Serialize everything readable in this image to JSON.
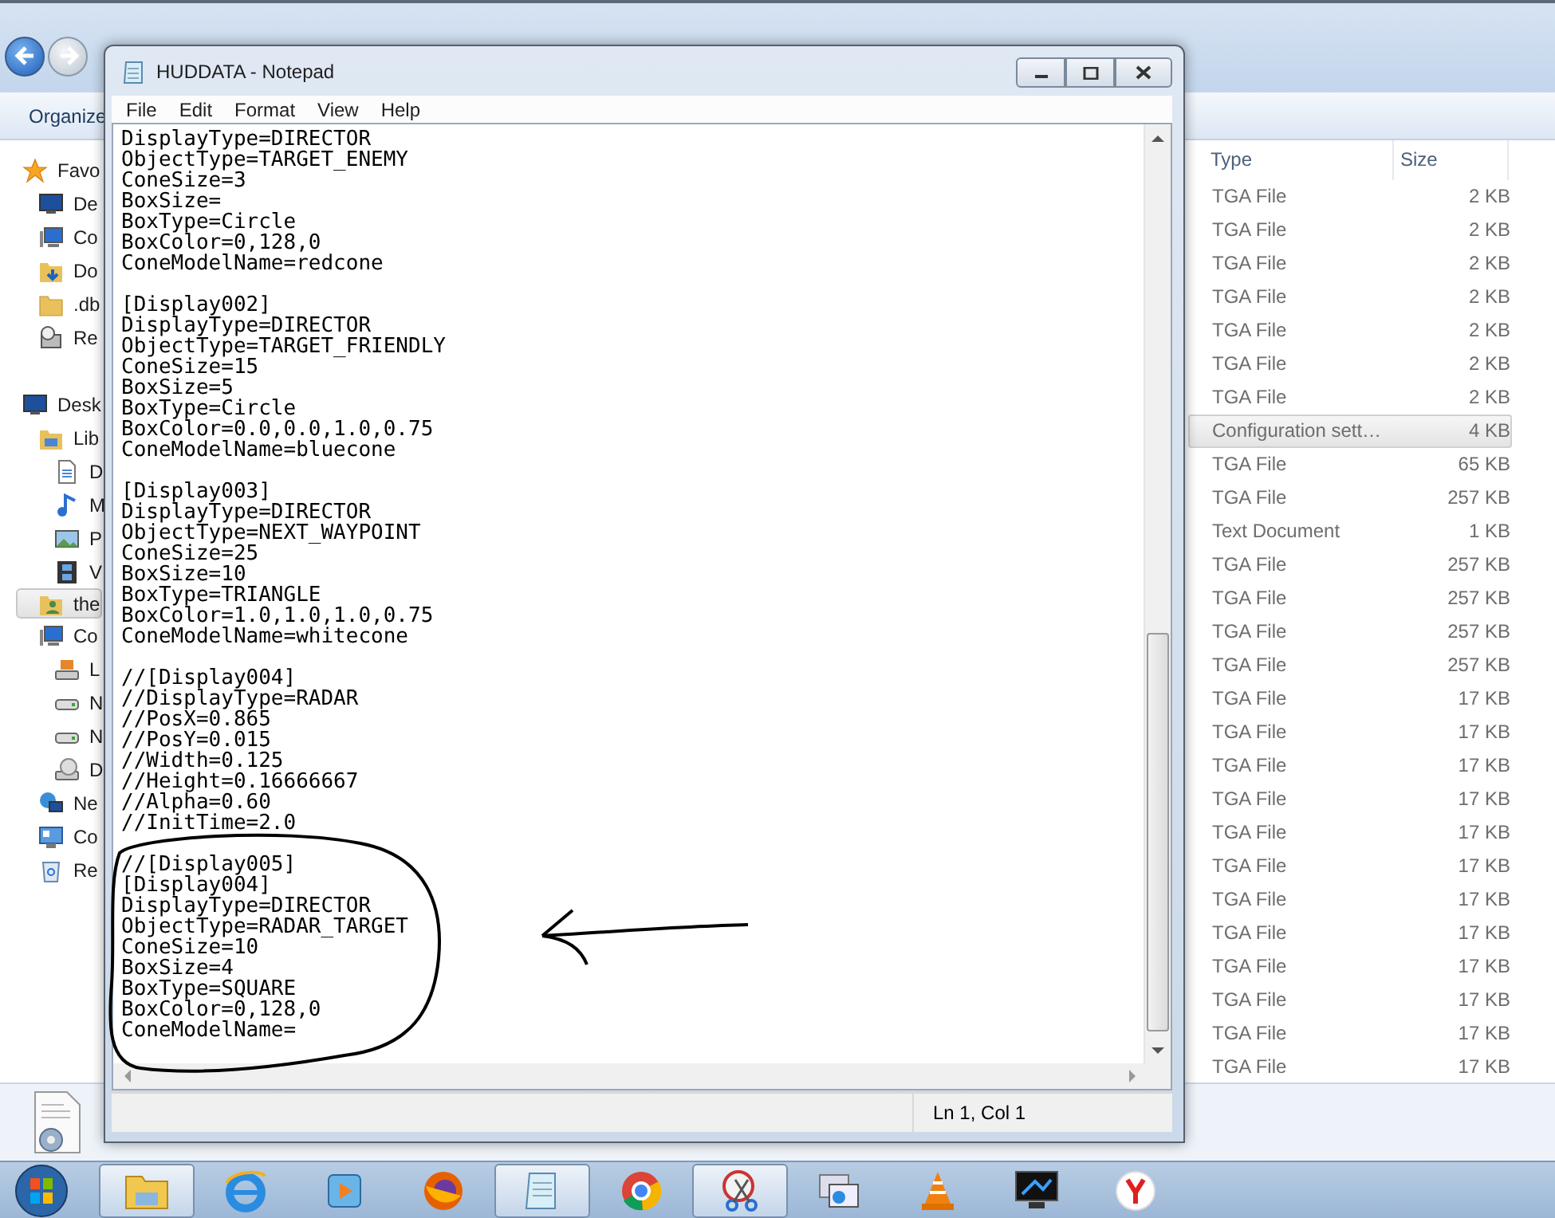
{
  "explorer": {
    "toolbar": {
      "organize": "Organize"
    },
    "nav": [
      {
        "label": "Favo",
        "kind": "star",
        "selected": false,
        "children": [
          {
            "label": "De",
            "kind": "desktop",
            "selected": false
          },
          {
            "label": "Co",
            "kind": "computer",
            "selected": false
          },
          {
            "label": "Do",
            "kind": "download",
            "selected": false
          },
          {
            "label": ".db",
            "kind": "folder",
            "selected": false
          },
          {
            "label": "Re",
            "kind": "recent",
            "selected": false
          }
        ]
      },
      {
        "label": "Desk",
        "kind": "desktop",
        "selected": false,
        "children": [
          {
            "label": "Lib",
            "kind": "library",
            "selected": false,
            "children": [
              {
                "label": "D",
                "kind": "document",
                "selected": false
              },
              {
                "label": "M",
                "kind": "music",
                "selected": false
              },
              {
                "label": "P",
                "kind": "picture",
                "selected": false
              },
              {
                "label": "V",
                "kind": "video",
                "selected": false
              }
            ]
          },
          {
            "label": "the",
            "kind": "user",
            "selected": true
          },
          {
            "label": "Co",
            "kind": "computer",
            "selected": false,
            "children": [
              {
                "label": "L",
                "kind": "windrive",
                "selected": false
              },
              {
                "label": "N",
                "kind": "drive",
                "selected": false
              },
              {
                "label": "N",
                "kind": "drive",
                "selected": false
              },
              {
                "label": "D",
                "kind": "dvd",
                "selected": false
              }
            ]
          },
          {
            "label": "Ne",
            "kind": "network",
            "selected": false
          },
          {
            "label": "Co",
            "kind": "control",
            "selected": false
          },
          {
            "label": "Re",
            "kind": "recycle",
            "selected": false
          }
        ]
      }
    ],
    "columns": [
      "Type",
      "Size"
    ],
    "files": [
      {
        "type": "TGA File",
        "size": "2 KB",
        "selected": false
      },
      {
        "type": "TGA File",
        "size": "2 KB",
        "selected": false
      },
      {
        "type": "TGA File",
        "size": "2 KB",
        "selected": false
      },
      {
        "type": "TGA File",
        "size": "2 KB",
        "selected": false
      },
      {
        "type": "TGA File",
        "size": "2 KB",
        "selected": false
      },
      {
        "type": "TGA File",
        "size": "2 KB",
        "selected": false
      },
      {
        "type": "TGA File",
        "size": "2 KB",
        "selected": false
      },
      {
        "type": "Configuration sett…",
        "size": "4 KB",
        "selected": true
      },
      {
        "type": "TGA File",
        "size": "65 KB",
        "selected": false
      },
      {
        "type": "TGA File",
        "size": "257 KB",
        "selected": false
      },
      {
        "type": "Text Document",
        "size": "1 KB",
        "selected": false
      },
      {
        "type": "TGA File",
        "size": "257 KB",
        "selected": false
      },
      {
        "type": "TGA File",
        "size": "257 KB",
        "selected": false
      },
      {
        "type": "TGA File",
        "size": "257 KB",
        "selected": false
      },
      {
        "type": "TGA File",
        "size": "257 KB",
        "selected": false
      },
      {
        "type": "TGA File",
        "size": "17 KB",
        "selected": false
      },
      {
        "type": "TGA File",
        "size": "17 KB",
        "selected": false
      },
      {
        "type": "TGA File",
        "size": "17 KB",
        "selected": false
      },
      {
        "type": "TGA File",
        "size": "17 KB",
        "selected": false
      },
      {
        "type": "TGA File",
        "size": "17 KB",
        "selected": false
      },
      {
        "type": "TGA File",
        "size": "17 KB",
        "selected": false
      },
      {
        "type": "TGA File",
        "size": "17 KB",
        "selected": false
      },
      {
        "type": "TGA File",
        "size": "17 KB",
        "selected": false
      },
      {
        "type": "TGA File",
        "size": "17 KB",
        "selected": false
      },
      {
        "type": "TGA File",
        "size": "17 KB",
        "selected": false
      },
      {
        "type": "TGA File",
        "size": "17 KB",
        "selected": false
      },
      {
        "type": "TGA File",
        "size": "17 KB",
        "selected": false
      }
    ]
  },
  "notepad": {
    "title": "HUDDATA - Notepad",
    "menu": [
      "File",
      "Edit",
      "Format",
      "View",
      "Help"
    ],
    "text": "DisplayType=DIRECTOR\nObjectType=TARGET_ENEMY\nConeSize=3\nBoxSize=\nBoxType=Circle\nBoxColor=0,128,0\nConeModelName=redcone\n\n[Display002]\nDisplayType=DIRECTOR\nObjectType=TARGET_FRIENDLY\nConeSize=15\nBoxSize=5\nBoxType=Circle\nBoxColor=0.0,0.0,1.0,0.75\nConeModelName=bluecone\n\n[Display003]\nDisplayType=DIRECTOR\nObjectType=NEXT_WAYPOINT\nConeSize=25\nBoxSize=10\nBoxType=TRIANGLE\nBoxColor=1.0,1.0,1.0,0.75\nConeModelName=whitecone\n\n//[Display004]\n//DisplayType=RADAR\n//PosX=0.865\n//PosY=0.015\n//Width=0.125\n//Height=0.16666667\n//Alpha=0.60\n//InitTime=2.0\n\n//[Display005]\n[Display004]\nDisplayType=DIRECTOR\nObjectType=RADAR_TARGET\nConeSize=10\nBoxSize=4\nBoxType=SQUARE\nBoxColor=0,128,0\nConeModelName=",
    "status": "Ln 1, Col 1"
  },
  "taskbar": {
    "items": [
      {
        "kind": "explorer",
        "active": true
      },
      {
        "kind": "ie",
        "active": false
      },
      {
        "kind": "media",
        "active": false
      },
      {
        "kind": "firefox",
        "active": false
      },
      {
        "kind": "notepad",
        "active": true
      },
      {
        "kind": "chrome",
        "active": false
      },
      {
        "kind": "snip",
        "active": true
      },
      {
        "kind": "windows",
        "active": false
      },
      {
        "kind": "vlc",
        "active": false
      },
      {
        "kind": "monitor",
        "active": false
      },
      {
        "kind": "yandex",
        "active": false
      }
    ]
  }
}
